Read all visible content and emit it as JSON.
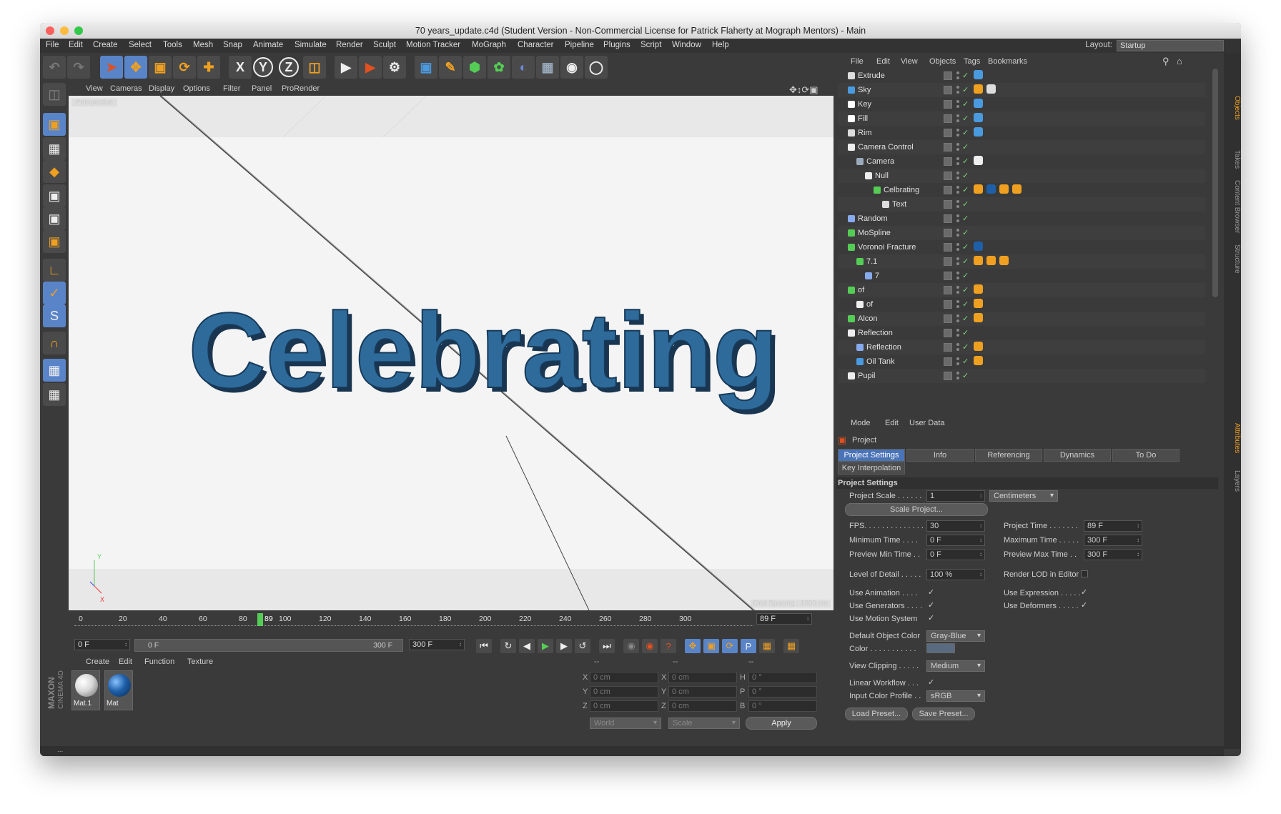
{
  "window": {
    "title": "70 years_update.c4d (Student Version - Non-Commercial License for Patrick Flaherty at Mograph Mentors) - Main"
  },
  "menubar": {
    "items": [
      "File",
      "Edit",
      "Create",
      "Select",
      "Tools",
      "Mesh",
      "Snap",
      "Animate",
      "Simulate",
      "Render",
      "Sculpt",
      "Motion Tracker",
      "MoGraph",
      "Character",
      "Pipeline",
      "Plugins",
      "Script",
      "Window",
      "Help"
    ],
    "layout_label": "Layout:",
    "layout_value": "Startup"
  },
  "toolbar": {
    "axis_x": "X",
    "axis_y": "Y",
    "axis_z": "Z"
  },
  "viewport": {
    "menu": [
      "View",
      "Cameras",
      "Display",
      "Options",
      "Filter",
      "Panel",
      "ProRender"
    ],
    "label_top": "Perspective",
    "label_bottom": "Grid Spacing : 1000 cm",
    "text_3d": "Celebrating",
    "axis_y": "Y",
    "axis_x": "X"
  },
  "timeline": {
    "ticks": [
      "0",
      "20",
      "40",
      "60",
      "80",
      "100",
      "120",
      "140",
      "160",
      "180",
      "200",
      "220",
      "240",
      "260",
      "280",
      "300"
    ],
    "current_frame_marker": "89",
    "current_frame_field": "89 F",
    "start_field": "0 F",
    "range_start": "0 F",
    "range_end": "300 F",
    "end_field": "300 F"
  },
  "materials": {
    "menu": [
      "Create",
      "Edit",
      "Function",
      "Texture"
    ],
    "items": [
      {
        "name": "Mat.1",
        "color": "#d8d8d8"
      },
      {
        "name": "Mat",
        "color": "#1e5fa8"
      }
    ]
  },
  "coords": {
    "headers": [
      "--",
      "--",
      "--"
    ],
    "rows": [
      {
        "a": "X",
        "av": "0 cm",
        "b": "X",
        "bv": "0 cm",
        "c": "H",
        "cv": "0 °"
      },
      {
        "a": "Y",
        "av": "0 cm",
        "b": "Y",
        "bv": "0 cm",
        "c": "P",
        "cv": "0 °"
      },
      {
        "a": "Z",
        "av": "0 cm",
        "b": "Z",
        "bv": "0 cm",
        "c": "B",
        "cv": "0 °"
      }
    ],
    "world": "World",
    "scale": "Scale",
    "apply": "Apply"
  },
  "objects": {
    "menu": [
      "File",
      "Edit",
      "View",
      "Objects",
      "Tags",
      "Bookmarks"
    ],
    "rows": [
      {
        "name": "Extrude",
        "depth": 0
      },
      {
        "name": "Sky",
        "depth": 0
      },
      {
        "name": "Key",
        "depth": 0
      },
      {
        "name": "Fill",
        "depth": 0
      },
      {
        "name": "Rim",
        "depth": 0
      },
      {
        "name": "Camera Control",
        "depth": 0
      },
      {
        "name": "Camera",
        "depth": 1
      },
      {
        "name": "Null",
        "depth": 2
      },
      {
        "name": "Celbrating",
        "depth": 3
      },
      {
        "name": "Text",
        "depth": 4
      },
      {
        "name": "Random",
        "depth": 0
      },
      {
        "name": "MoSpline",
        "depth": 0
      },
      {
        "name": "Voronoi Fracture",
        "depth": 0
      },
      {
        "name": "7.1",
        "depth": 1
      },
      {
        "name": "7",
        "depth": 2
      },
      {
        "name": "of",
        "depth": 0
      },
      {
        "name": "of",
        "depth": 1
      },
      {
        "name": "Alcon",
        "depth": 0
      },
      {
        "name": "Reflection",
        "depth": 0
      },
      {
        "name": "Reflection",
        "depth": 1
      },
      {
        "name": "Oil Tank",
        "depth": 1
      },
      {
        "name": "Pupil",
        "depth": 0
      }
    ]
  },
  "attributes": {
    "menu": [
      "Mode",
      "Edit",
      "User Data"
    ],
    "header": "Project",
    "tabs": [
      "Project Settings",
      "Info",
      "Referencing",
      "Dynamics",
      "To Do"
    ],
    "tab2": "Key Interpolation",
    "section": "Project Settings",
    "project_scale_label": "Project Scale . . . . . .",
    "project_scale_value": "1",
    "project_scale_unit": "Centimeters",
    "scale_project_btn": "Scale Project...",
    "fps_label": "FPS. . . . . . . . . . . . . .",
    "fps_value": "30",
    "project_time_label": "Project Time . . . . . . .",
    "project_time_value": "89 F",
    "min_time_label": "Minimum Time . . . .",
    "min_time_value": "0 F",
    "max_time_label": "Maximum Time . . . . .",
    "max_time_value": "300 F",
    "prev_min_label": "Preview Min Time . .",
    "prev_min_value": "0 F",
    "prev_max_label": "Preview Max Time . .",
    "prev_max_value": "300 F",
    "lod_label": "Level of Detail . . . . .",
    "lod_value": "100 %",
    "render_lod_label": "Render LOD in Editor",
    "use_anim_label": "Use Animation . . . .",
    "use_expr_label": "Use Expression . . . . .",
    "use_gen_label": "Use Generators . . . .",
    "use_def_label": "Use Deformers . . . . .",
    "use_motion_label": "Use Motion System",
    "default_color_label": "Default Object Color",
    "default_color_value": "Gray-Blue",
    "color_label": "Color . . . . . . . . . . .",
    "view_clip_label": "View Clipping . . . . .",
    "view_clip_value": "Medium",
    "linear_wf_label": "Linear Workflow . . .",
    "input_profile_label": "Input Color Profile . .",
    "input_profile_value": "sRGB",
    "load_preset": "Load Preset...",
    "save_preset": "Save Preset..."
  },
  "side_tabs": [
    "Objects",
    "Takes",
    "Content Browser",
    "Structure",
    "Attributes",
    "Layers"
  ],
  "brand": {
    "maxon": "MAXON",
    "c4d": "CINEMA 4D"
  },
  "status_text": "...",
  "colors": {
    "accent": "#4a74b8",
    "text3d": "#2f6b9a",
    "highlight": "#5a84c8"
  }
}
